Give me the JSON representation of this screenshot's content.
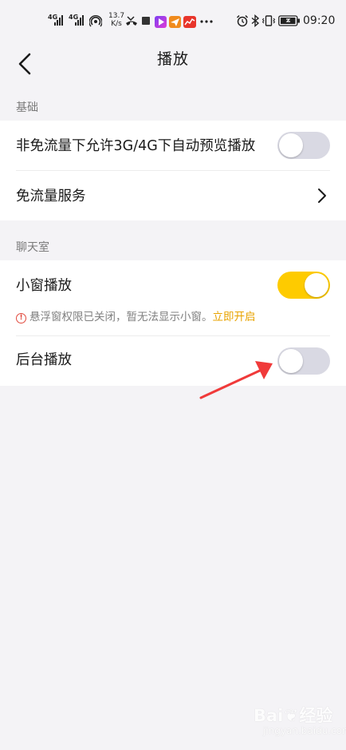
{
  "status_bar": {
    "signal_1_tag": "4G",
    "signal_2_tag": "4G",
    "net_speed_value": "13.7",
    "net_speed_unit": "K/s",
    "time": "09:20",
    "icons": [
      "hotspot-icon",
      "missed-call-icon",
      "stop-square-icon",
      "video-app-icon",
      "paper-plane-app-icon",
      "stock-app-icon",
      "more-dots-icon",
      "alarm-icon",
      "bluetooth-icon",
      "vibrate-icon",
      "battery-icon"
    ]
  },
  "header": {
    "title": "播放",
    "back_icon": "chevron-left-icon"
  },
  "sections": {
    "basic": {
      "label": "基础",
      "rows": [
        {
          "label": "非免流量下允许3G/4G下自动预览播放",
          "control": "toggle",
          "on": false
        },
        {
          "label": "免流量服务",
          "control": "chevron-right-icon"
        }
      ]
    },
    "chatroom": {
      "label": "聊天室",
      "rows": [
        {
          "label": "小窗播放",
          "control": "toggle",
          "on": true
        },
        {
          "label": "后台播放",
          "control": "toggle",
          "on": false
        }
      ],
      "notice": {
        "text": "悬浮窗权限已关闭，暂无法显示小窗。",
        "link": "立即开启",
        "icon": "exclamation-circle-icon"
      }
    }
  },
  "colors": {
    "background": "#f4f3f6",
    "card": "#ffffff",
    "toggle_on": "#fecb00",
    "toggle_off": "#d9d9e3",
    "link": "#e8a300",
    "warning": "#e24a3e",
    "annotation_arrow": "#f03a3a"
  },
  "watermark": {
    "brand": "Bai",
    "brand_suffix": "经验",
    "sub": "jingyan.baidu.com"
  }
}
